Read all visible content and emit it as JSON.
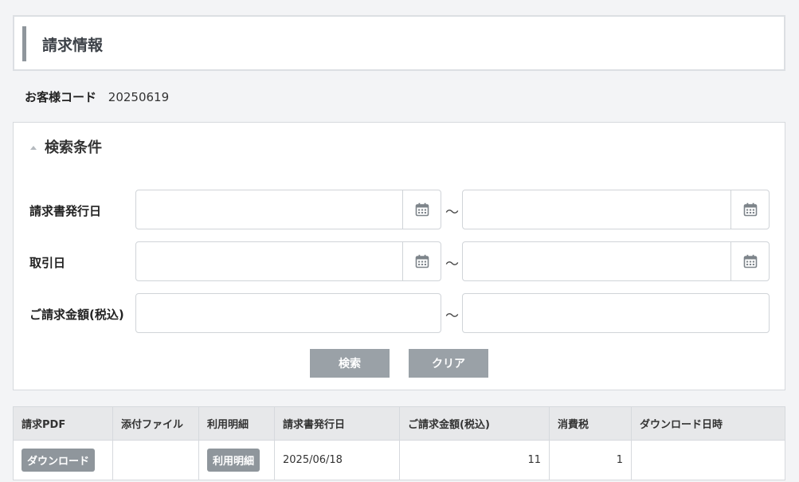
{
  "page": {
    "title": "請求情報"
  },
  "customer": {
    "label": "お客様コード",
    "value": "20250619"
  },
  "search": {
    "title": "検索条件",
    "separator": "〜",
    "rows": {
      "issue_date": {
        "label": "請求書発行日"
      },
      "trade_date": {
        "label": "取引日"
      },
      "amount": {
        "label": "ご請求金額(税込)"
      }
    },
    "search_button": "検索",
    "clear_button": "クリア"
  },
  "table": {
    "columns": [
      "請求PDF",
      "添付ファイル",
      "利用明細",
      "請求書発行日",
      "ご請求金額(税込)",
      "消費税",
      "ダウンロード日時"
    ],
    "rows": [
      {
        "pdf_button": "ダウンロード",
        "attachment": "",
        "detail_button": "利用明細",
        "issue_date": "2025/06/18",
        "amount": "11",
        "tax": "1",
        "download_datetime": ""
      }
    ]
  },
  "colors": {
    "button": "#9aa1a7",
    "accent_bar": "#8f969c",
    "header_bg": "#e7e8ea"
  },
  "icons": {
    "date_picker": "calendar-icon",
    "collapse": "triangle-up-icon"
  }
}
